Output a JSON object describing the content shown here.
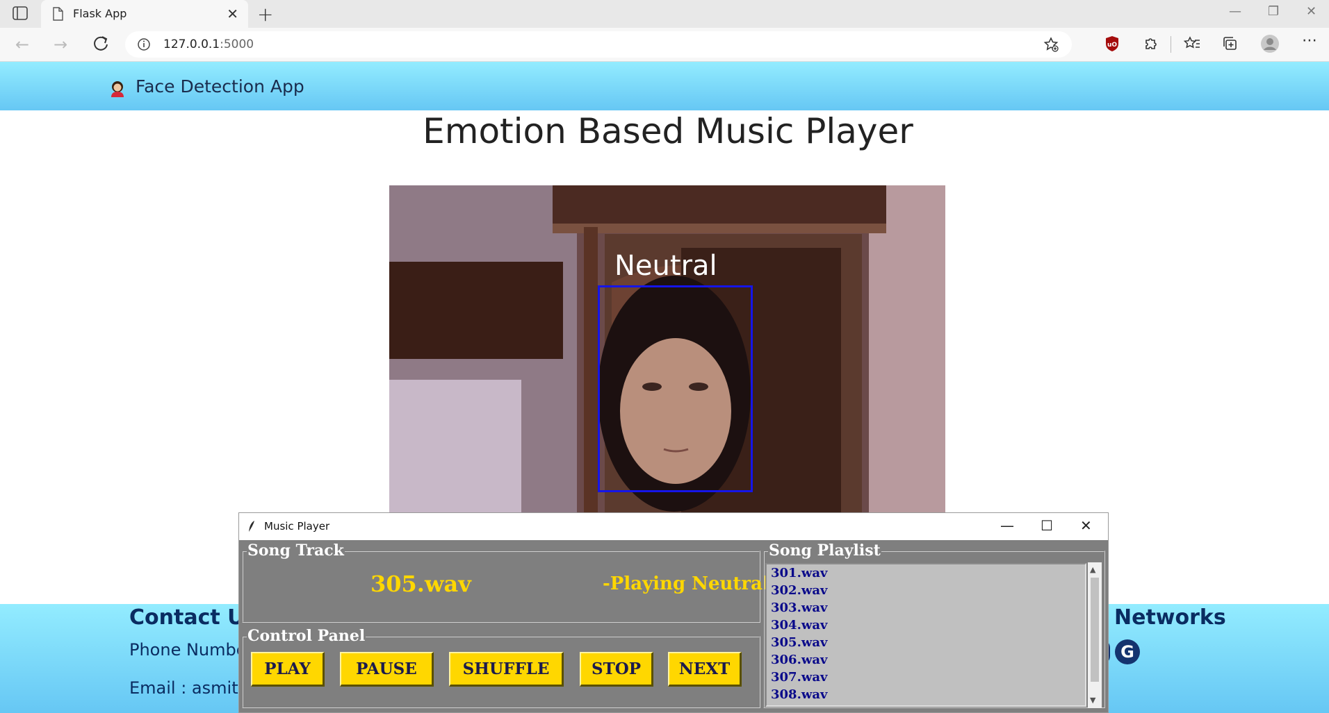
{
  "browser": {
    "tab_title": "Flask App",
    "url_host": "127.0.0.1",
    "url_port": ":5000"
  },
  "navbar": {
    "brand": "Face Detection App"
  },
  "main": {
    "heading": "Emotion Based Music Player",
    "detected_emotion": "Neutral"
  },
  "footer": {
    "contact_title": "Contact Us",
    "phone_label": "Phone Number",
    "email_label": "Email : asmitag",
    "networks_title": "Networks"
  },
  "music_player": {
    "window_title": "Music Player",
    "song_track_title": "Song Track",
    "current_song": "305.wav",
    "status": "-Playing Neutral",
    "control_panel_title": "Control Panel",
    "buttons": [
      "PLAY",
      "PAUSE",
      "SHUFFLE",
      "STOP",
      "NEXT"
    ],
    "playlist_title": "Song Playlist",
    "playlist": [
      "301.wav",
      "302.wav",
      "303.wav",
      "304.wav",
      "305.wav",
      "306.wav",
      "307.wav",
      "308.wav"
    ]
  },
  "colors": {
    "nav_gradient": [
      "#93ecff",
      "#66c7f4"
    ],
    "button_bg": "#ffd700",
    "song_text": "#ffd700",
    "face_box": "#1515e8"
  }
}
